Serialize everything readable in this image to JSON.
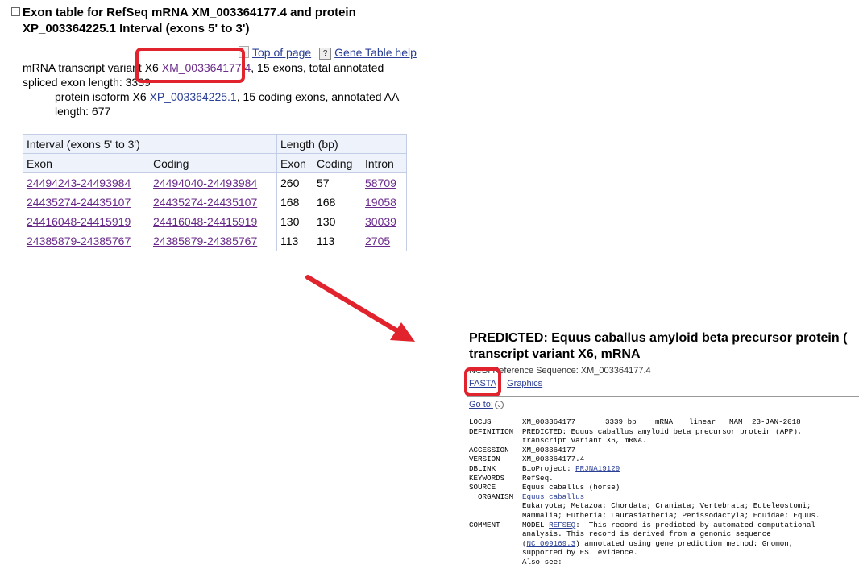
{
  "exon_panel": {
    "collapse_symbol": "⊟",
    "title": "Exon table for RefSeq mRNA XM_003364177.4 and protein XP_003364225.1 Interval (exons 5' to 3')",
    "top_of_page_label": "Top of page",
    "gene_table_help_label": "Gene Table help",
    "mrna_prefix": "mRNA transcript variant X6 ",
    "mrna_accession": "XM_003364177.4",
    "mrna_suffix": ", 15 exons, total annotated spliced exon length: 3339",
    "protein_prefix": "protein isoform X6 ",
    "protein_accession": "XP_003364225.1",
    "protein_suffix": ", 15 coding exons, annotated AA length: 677",
    "table": {
      "group_interval": "Interval (exons 5' to 3')",
      "group_length": "Length (bp)",
      "columns": [
        "Exon",
        "Coding",
        "Exon",
        "Coding",
        "Intron"
      ],
      "rows": [
        {
          "exon": "24494243-24493984",
          "coding": "24494040-24493984",
          "exon_len": "260",
          "coding_len": "57",
          "intron": "58709"
        },
        {
          "exon": "24435274-24435107",
          "coding": "24435274-24435107",
          "exon_len": "168",
          "coding_len": "168",
          "intron": "19058"
        },
        {
          "exon": "24416048-24415919",
          "coding": "24416048-24415919",
          "exon_len": "130",
          "coding_len": "130",
          "intron": "30039"
        },
        {
          "exon": "24385879-24385767",
          "coding": "24385879-24385767",
          "exon_len": "113",
          "coding_len": "113",
          "intron": "2705"
        }
      ]
    }
  },
  "record": {
    "title_line1": "PREDICTED: Equus caballus amyloid beta precursor protein (",
    "title_line2": "transcript variant X6, mRNA",
    "subtitle": "NCBI Reference Sequence: XM_003364177.4",
    "fasta_label": "FASTA",
    "graphics_label": "Graphics",
    "goto_label": "Go to:",
    "goto_icon": "chevron-down",
    "locus": {
      "key": "LOCUS",
      "name": "XM_003364177",
      "length": "3339 bp",
      "moltype": "mRNA",
      "topology": "linear",
      "division": "MAM",
      "date": "23-JAN-2018"
    },
    "definition": {
      "key": "DEFINITION",
      "lines": [
        "PREDICTED: Equus caballus amyloid beta precursor protein (APP),",
        "transcript variant X6, mRNA."
      ]
    },
    "accession": {
      "key": "ACCESSION",
      "value": "XM_003364177"
    },
    "version": {
      "key": "VERSION",
      "value": "XM_003364177.4"
    },
    "dblink": {
      "key": "DBLINK",
      "prefix": "BioProject: ",
      "link": "PRJNA19129"
    },
    "keywords": {
      "key": "KEYWORDS",
      "value": "RefSeq."
    },
    "source": {
      "key": "SOURCE",
      "value": "Equus caballus (horse)"
    },
    "organism": {
      "key": "  ORGANISM",
      "link": "Equus caballus",
      "lines": [
        "Eukaryota; Metazoa; Chordata; Craniata; Vertebrata; Euteleostomi;",
        "Mammalia; Eutheria; Laurasiatheria; Perissodactyla; Equidae; Equus."
      ]
    },
    "comment": {
      "key": "COMMENT",
      "l1_prefix": "MODEL ",
      "l1_link": "REFSEQ",
      "l1_suffix": ":  This record is predicted by automated computational",
      "l2": "analysis. This record is derived from a genomic sequence",
      "l3_prefix": "(",
      "l3_link": "NC_009169.3",
      "l3_suffix": ") annotated using gene prediction method: Gnomon,",
      "l4": "supported by EST evidence.",
      "l5": "Also see:"
    }
  },
  "annotation_color": "#e0232c"
}
